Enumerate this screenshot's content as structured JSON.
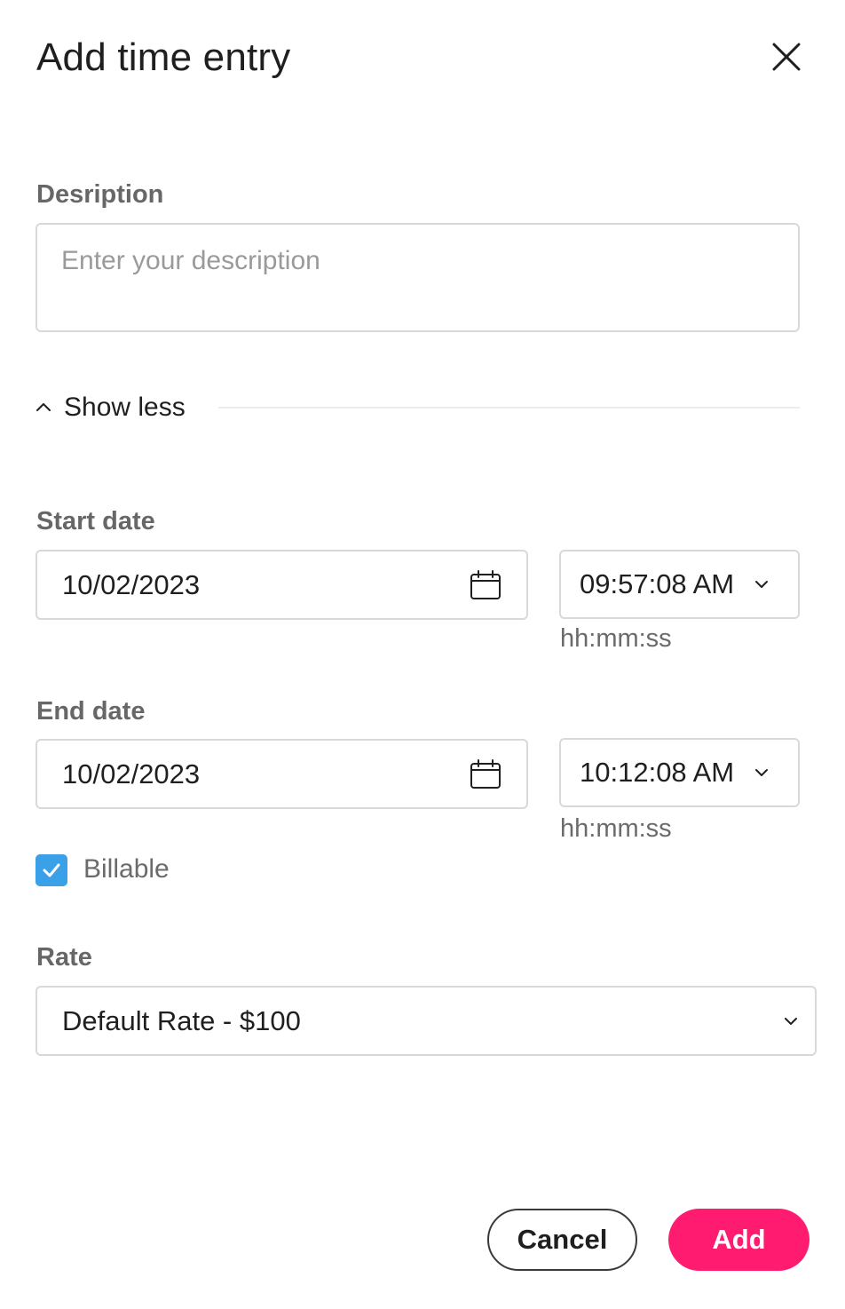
{
  "dialog": {
    "title": "Add time entry"
  },
  "description": {
    "label": "Desription",
    "placeholder": "Enter your description",
    "value": ""
  },
  "toggle": {
    "label": "Show less",
    "icon": "chevron-up-icon"
  },
  "start": {
    "label": "Start date",
    "date": "10/02/2023",
    "time": "09:57:08 AM",
    "time_hint": "hh:mm:ss"
  },
  "end": {
    "label": "End date",
    "date": "10/02/2023",
    "time": "10:12:08 AM",
    "time_hint": "hh:mm:ss"
  },
  "billable": {
    "label": "Billable",
    "checked": true
  },
  "rate": {
    "label": "Rate",
    "value": "Default Rate - $100"
  },
  "actions": {
    "cancel_label": "Cancel",
    "add_label": "Add"
  },
  "colors": {
    "accent": "#ff1c70",
    "checkbox": "#3aa0e8"
  }
}
